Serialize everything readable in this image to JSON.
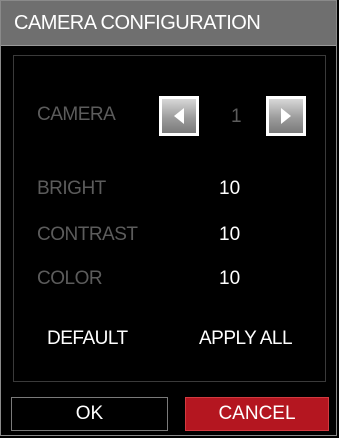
{
  "window": {
    "title": "CAMERA CONFIGURATION"
  },
  "camera": {
    "label": "CAMERA",
    "value": "1",
    "prev_icon": "left-arrow-icon",
    "next_icon": "right-arrow-icon"
  },
  "settings": [
    {
      "label": "BRIGHT",
      "value": "10"
    },
    {
      "label": "CONTRAST",
      "value": "10"
    },
    {
      "label": "COLOR",
      "value": "10"
    }
  ],
  "actions": {
    "default_label": "DEFAULT",
    "apply_all_label": "APPLY ALL"
  },
  "footer": {
    "ok_label": "OK",
    "cancel_label": "CANCEL"
  },
  "colors": {
    "title_bar": "#6f6f6f",
    "background": "#000000",
    "dim_label": "#5c5c5c",
    "cancel_bg": "#b41620"
  }
}
